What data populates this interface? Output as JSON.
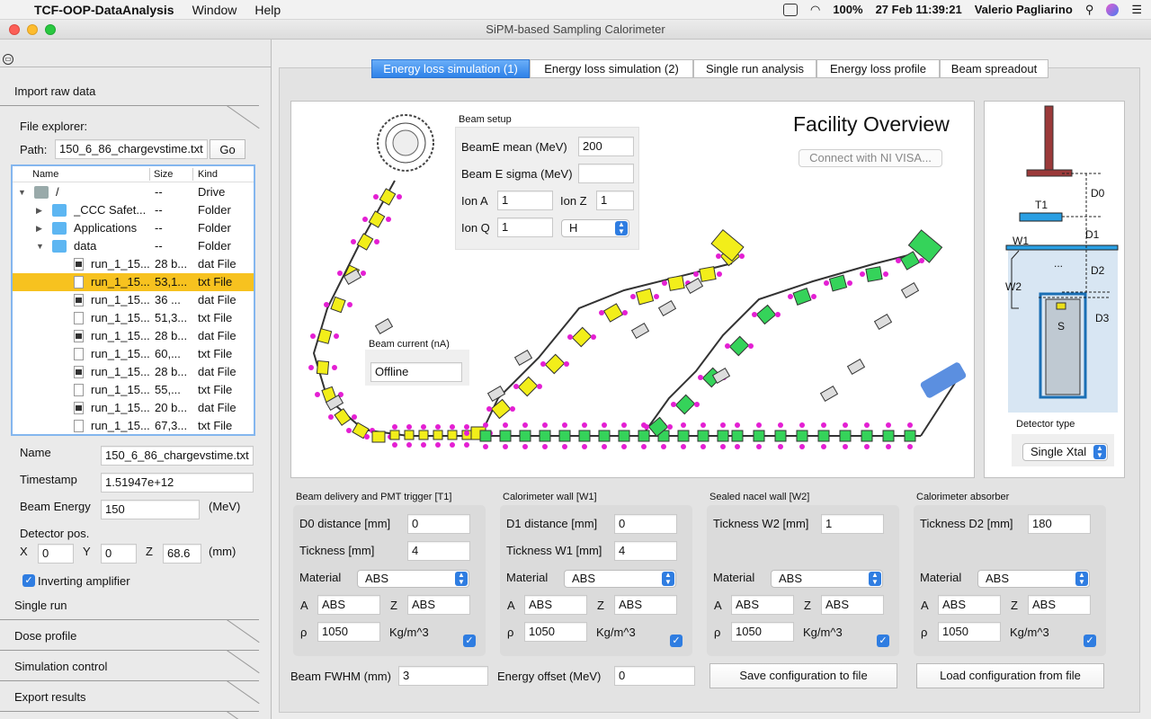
{
  "menubar": {
    "apple_icon": "apple-icon",
    "app_name": "TCF-OOP-DataAnalysis",
    "items": [
      "Window",
      "Help"
    ],
    "battery": "100%",
    "datetime": "27 Feb  11:39:21",
    "user": "Valerio Pagliarino"
  },
  "window": {
    "title": "SiPM-based Sampling Calorimeter"
  },
  "sidebar": {
    "import_section": "Import raw data",
    "file_explorer_label": "File explorer:",
    "path_label": "Path:",
    "path_value": "150_6_86_chargevstime.txt",
    "go_button": "Go",
    "columns": [
      "Name",
      "Size",
      "Kind"
    ],
    "tree_rows": [
      {
        "name": "/",
        "size": "--",
        "kind": "Drive",
        "icon": "drive-icon",
        "indent": 0,
        "arrow": "▼",
        "selected": false
      },
      {
        "name": "_CCC Safet...",
        "size": "--",
        "kind": "Folder",
        "icon": "folder-icon",
        "indent": 1,
        "arrow": "▶",
        "selected": false
      },
      {
        "name": "Applications",
        "size": "--",
        "kind": "Folder",
        "icon": "folder-icon",
        "indent": 1,
        "arrow": "▶",
        "selected": false
      },
      {
        "name": "data",
        "size": "--",
        "kind": "Folder",
        "icon": "folder-icon",
        "indent": 1,
        "arrow": "▼",
        "selected": false
      },
      {
        "name": "run_1_15...",
        "size": "28 b...",
        "kind": "dat File",
        "icon": "dat-file-icon",
        "indent": 2,
        "arrow": "",
        "selected": false
      },
      {
        "name": "run_1_15...",
        "size": "53,1...",
        "kind": "txt File",
        "icon": "txt-file-icon",
        "indent": 2,
        "arrow": "",
        "selected": true
      },
      {
        "name": "run_1_15...",
        "size": "36 ...",
        "kind": "dat File",
        "icon": "dat-file-icon",
        "indent": 2,
        "arrow": "",
        "selected": false
      },
      {
        "name": "run_1_15...",
        "size": "51,3...",
        "kind": "txt File",
        "icon": "txt-file-icon",
        "indent": 2,
        "arrow": "",
        "selected": false
      },
      {
        "name": "run_1_15...",
        "size": "28 b...",
        "kind": "dat File",
        "icon": "dat-file-icon",
        "indent": 2,
        "arrow": "",
        "selected": false
      },
      {
        "name": "run_1_15...",
        "size": "60,...",
        "kind": "txt File",
        "icon": "txt-file-icon",
        "indent": 2,
        "arrow": "",
        "selected": false
      },
      {
        "name": "run_1_15...",
        "size": "28 b...",
        "kind": "dat File",
        "icon": "dat-file-icon",
        "indent": 2,
        "arrow": "",
        "selected": false
      },
      {
        "name": "run_1_15...",
        "size": "55,...",
        "kind": "txt File",
        "icon": "txt-file-icon",
        "indent": 2,
        "arrow": "",
        "selected": false
      },
      {
        "name": "run_1_15...",
        "size": "20 b...",
        "kind": "dat File",
        "icon": "dat-file-icon",
        "indent": 2,
        "arrow": "",
        "selected": false
      },
      {
        "name": "run_1_15...",
        "size": "67,3...",
        "kind": "txt File",
        "icon": "txt-file-icon",
        "indent": 2,
        "arrow": "",
        "selected": false
      }
    ],
    "name_label": "Name",
    "name_value": "150_6_86_chargevstime.txt",
    "timestamp_label": "Timestamp",
    "timestamp_value": "1.51947e+12",
    "beam_energy_label": "Beam Energy",
    "beam_energy_value": "150",
    "beam_energy_unit": "(MeV)",
    "detector_pos_label": "Detector pos.",
    "x_label": "X",
    "x_value": "0",
    "y_label": "Y",
    "y_value": "0",
    "z_label": "Z",
    "z_value": "68.6",
    "pos_unit": "(mm)",
    "inverting_label": "Inverting amplifier",
    "other_sections": [
      "Single run",
      "Dose profile",
      "Simulation control",
      "Export results"
    ]
  },
  "tabs": [
    {
      "label": "Energy loss simulation (1)",
      "active": true
    },
    {
      "label": "Energy loss simulation (2)",
      "active": false
    },
    {
      "label": "Single run analysis",
      "active": false
    },
    {
      "label": "Energy loss profile",
      "active": false
    },
    {
      "label": "Beam spreadout",
      "active": false
    }
  ],
  "facility": {
    "title": "Facility Overview",
    "connect_button": "Connect with NI VISA...",
    "beam_setup_label": "Beam setup",
    "beamE_mean_label": "BeamE mean (MeV)",
    "beamE_mean_value": "200",
    "beamE_sigma_label": "Beam E sigma (MeV)",
    "beamE_sigma_value": "",
    "ion_a_label": "Ion A",
    "ion_a_value": "1",
    "ion_z_label": "Ion Z",
    "ion_z_value": "1",
    "ion_q_label": "Ion Q",
    "ion_q_value": "1",
    "ion_species": "H",
    "beam_current_label": "Beam current (nA)",
    "beam_current_value": "Offline",
    "beamline_markers": "!A"
  },
  "detector": {
    "labels": [
      "D0",
      "T1",
      "D1",
      "W1",
      "D2",
      "W2",
      "S",
      "D3"
    ],
    "dots": "...",
    "type_label": "Detector type",
    "type_value": "Single Xtal"
  },
  "groups": [
    {
      "title": "Beam delivery and PMT trigger [T1]",
      "f1_label": "D0 distance [mm]",
      "f1_value": "0",
      "f2_label": "Tickness [mm]",
      "f2_value": "4",
      "material_label": "Material",
      "material": "ABS",
      "a_label": "A",
      "a_value": "ABS",
      "z_label": "Z",
      "z_value": "ABS",
      "rho_label": "ρ",
      "rho_value": "1050",
      "rho_unit": "Kg/m^3"
    },
    {
      "title": "Calorimeter wall [W1]",
      "f1_label": "D1 distance [mm]",
      "f1_value": "0",
      "f2_label": "Tickness W1 [mm]",
      "f2_value": "4",
      "material_label": "Material",
      "material": "ABS",
      "a_label": "A",
      "a_value": "ABS",
      "z_label": "Z",
      "z_value": "ABS",
      "rho_label": "ρ",
      "rho_value": "1050",
      "rho_unit": "Kg/m^3"
    },
    {
      "title": "Sealed nacel wall [W2]",
      "f1_label": "Tickness W2 [mm]",
      "f1_value": "1",
      "f2_label": "",
      "f2_value": "",
      "material_label": "Material",
      "material": "ABS",
      "a_label": "A",
      "a_value": "ABS",
      "z_label": "Z",
      "z_value": "ABS",
      "rho_label": "ρ",
      "rho_value": "1050",
      "rho_unit": "Kg/m^3"
    },
    {
      "title": "Calorimeter absorber",
      "f1_label": "Tickness D2 [mm]",
      "f1_value": "180",
      "f2_label": "",
      "f2_value": "",
      "material_label": "Material",
      "material": "ABS",
      "a_label": "A",
      "a_value": "ABS",
      "z_label": "Z",
      "z_value": "ABS",
      "rho_label": "ρ",
      "rho_value": "1050",
      "rho_unit": "Kg/m^3"
    }
  ],
  "bottom": {
    "fwhm_label": "Beam FWHM (mm)",
    "fwhm_value": "3",
    "offset_label": "Energy offset (MeV)",
    "offset_value": "0",
    "save_button": "Save configuration to file",
    "load_button": "Load configuration from file"
  },
  "colors": {
    "accent": "#2f7de1",
    "selection": "#f7c21f",
    "magnet_yellow": "#f2ee1a",
    "magnet_green": "#35d35a",
    "magenta": "#e41fd3"
  }
}
